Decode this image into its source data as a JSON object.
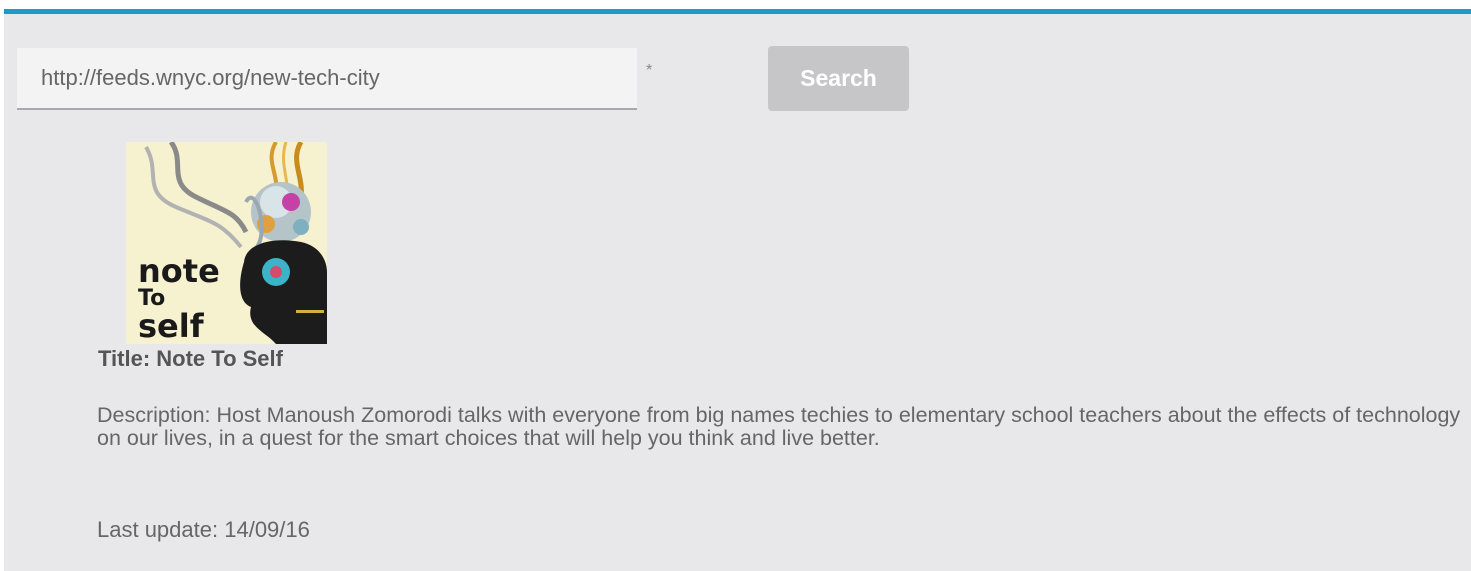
{
  "search": {
    "feed_url": "http://feeds.wnyc.org/new-tech-city",
    "required_marker": "*",
    "button_label": "Search"
  },
  "podcast": {
    "cover_lettering": "note to self",
    "title_label": "Title:",
    "title": "Note To Self",
    "description_label": "Description:",
    "description": "Host Manoush Zomorodi talks with everyone from big names techies to elementary school teachers about the effects of technology on our lives, in a quest for the smart choices that will help you think and live better.",
    "last_update_label": "Last update:",
    "last_update": "14/09/16"
  },
  "colors": {
    "accent": "#1a9cc9",
    "panel_background": "#e8e8ea",
    "button_disabled": "#c6c6c8"
  }
}
